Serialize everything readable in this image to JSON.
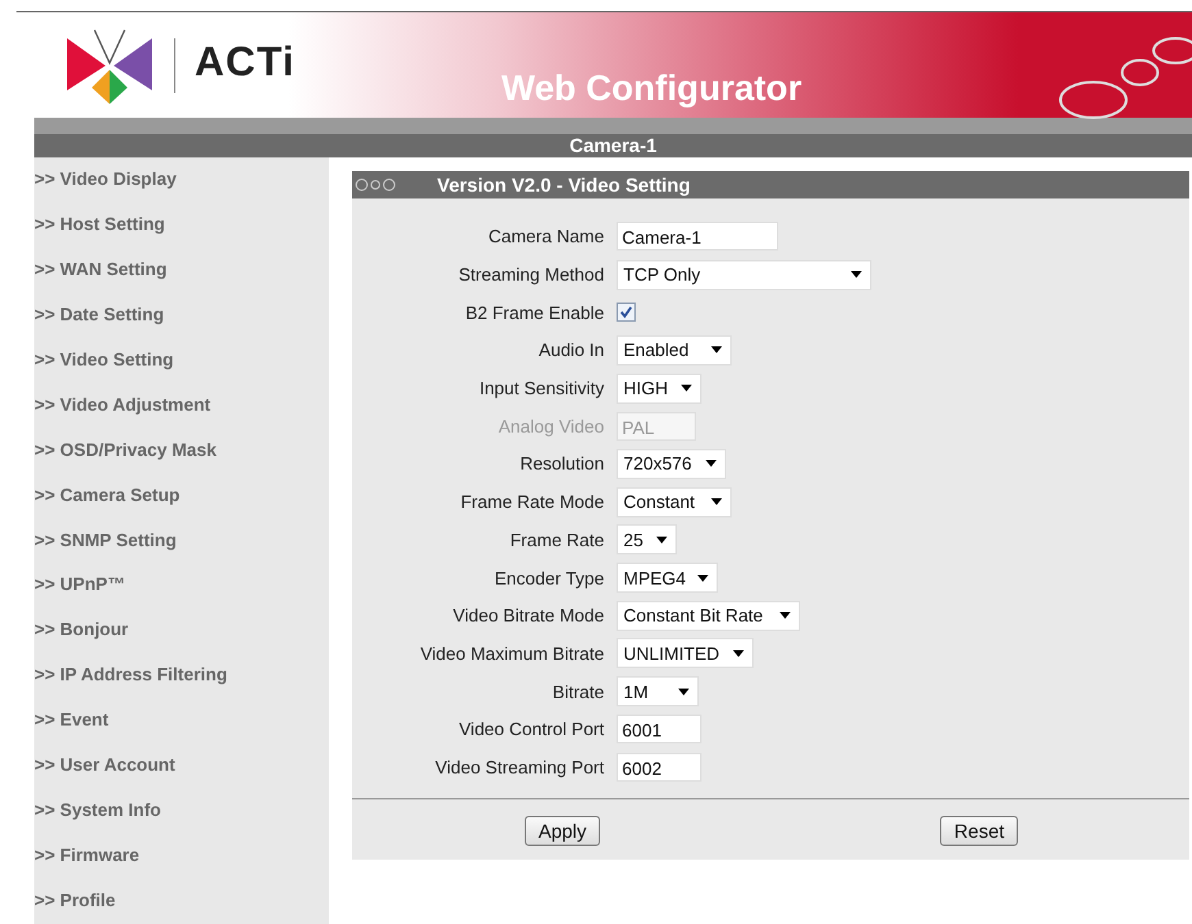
{
  "header": {
    "brand": "ACTi",
    "title": "Web Configurator",
    "device": "Camera-1"
  },
  "sidebar": {
    "items": [
      {
        "label": ">> Video Display"
      },
      {
        "label": ">> Host Setting"
      },
      {
        "label": ">> WAN Setting"
      },
      {
        "label": ">> Date Setting"
      },
      {
        "label": ">> Video Setting"
      },
      {
        "label": ">> Video Adjustment"
      },
      {
        "label": ">> OSD/Privacy Mask"
      },
      {
        "label": ">> Camera Setup"
      },
      {
        "label": ">> SNMP Setting"
      },
      {
        "label": ">> UPnP™"
      },
      {
        "label": ">> Bonjour"
      },
      {
        "label": ">> IP Address Filtering"
      },
      {
        "label": ">> Event"
      },
      {
        "label": ">> User Account"
      },
      {
        "label": ">> System Info"
      },
      {
        "label": ">> Firmware"
      },
      {
        "label": ">> Profile"
      }
    ]
  },
  "panel": {
    "title": "Version V2.0 - Video Setting",
    "fields": [
      {
        "label": "Camera Name",
        "kind": "text",
        "value": "Camera-1",
        "disabled": false
      },
      {
        "label": "Streaming Method",
        "kind": "select",
        "value": "TCP Only",
        "disabled": false
      },
      {
        "label": "B2 Frame Enable",
        "kind": "checkbox",
        "checked": true,
        "disabled": false
      },
      {
        "label": "Audio In",
        "kind": "select",
        "value": "Enabled",
        "disabled": false
      },
      {
        "label": "Input Sensitivity",
        "kind": "select",
        "value": "HIGH",
        "disabled": false
      },
      {
        "label": "Analog Video",
        "kind": "text",
        "value": "PAL",
        "disabled": true
      },
      {
        "label": "Resolution",
        "kind": "select",
        "value": "720x576",
        "disabled": false
      },
      {
        "label": "Frame Rate Mode",
        "kind": "select",
        "value": "Constant",
        "disabled": false
      },
      {
        "label": "Frame Rate",
        "kind": "select",
        "value": "25",
        "disabled": false
      },
      {
        "label": "Encoder Type",
        "kind": "select",
        "value": "MPEG4",
        "disabled": false
      },
      {
        "label": "Video Bitrate Mode",
        "kind": "select",
        "value": "Constant Bit Rate",
        "disabled": false
      },
      {
        "label": "Video Maximum Bitrate",
        "kind": "select",
        "value": "UNLIMITED",
        "disabled": false
      },
      {
        "label": "Bitrate",
        "kind": "select",
        "value": "1M",
        "disabled": false
      },
      {
        "label": "Video Control Port",
        "kind": "text",
        "value": "6001",
        "disabled": false
      },
      {
        "label": "Video Streaming Port",
        "kind": "text",
        "value": "6002",
        "disabled": false
      }
    ],
    "buttons": [
      "Apply",
      "Reset"
    ]
  }
}
